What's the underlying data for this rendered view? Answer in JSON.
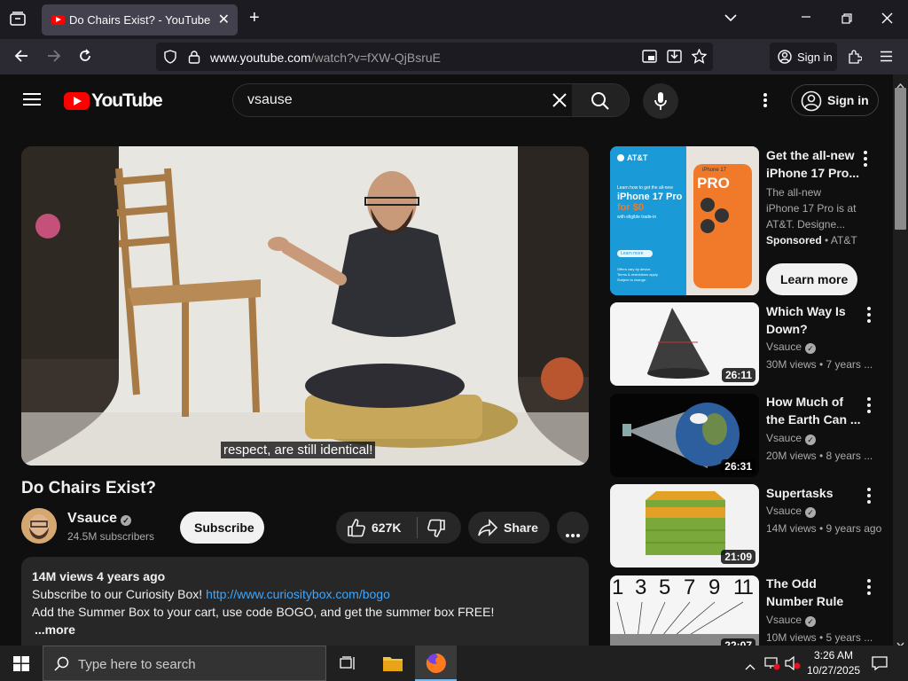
{
  "browser": {
    "tab_title": "Do Chairs Exist? - YouTube",
    "url_host": "www.youtube.com",
    "url_path": "/watch?v=fXW-QjBsruE",
    "signin_label": "Sign in"
  },
  "header": {
    "logo_text": "YouTube",
    "search_value": "vsause",
    "signin_label": "Sign in"
  },
  "video": {
    "caption": "respect, are still identical!",
    "title": "Do Chairs Exist?",
    "channel": "Vsauce",
    "subscribers": "24.5M subscribers",
    "subscribe_label": "Subscribe",
    "likes": "627K",
    "share_label": "Share"
  },
  "description": {
    "meta": "14M views  4 years ago",
    "line1_text": "Subscribe to our Curiosity Box! ",
    "line1_link": "http://www.curiositybox.com/bogo",
    "line2": "Add the Summer Box to your cart, use code BOGO, and get the summer box FREE!",
    "more": "...more"
  },
  "sidebar": {
    "ad": {
      "title": "Get the all-new iPhone 17 Pro...",
      "desc": "The all-new iPhone 17 Pro is at AT&T. Designe...",
      "sponsored": "Sponsored",
      "advertiser": "AT&T",
      "cta": "Learn more",
      "thumb_brand": "AT&T",
      "thumb_tag": "iPhone 17",
      "thumb_pro": "PRO",
      "thumb_headline1": "iPhone 17 Pro",
      "thumb_headline2": "for $0",
      "thumb_small": "Learn how to get the all-new",
      "thumb_trade": "with eligible trade-in",
      "thumb_btn": "Learn more",
      "thumb_fine1": "Offers vary by device.",
      "thumb_fine2": "Terms & restrictions apply.",
      "thumb_fine3": "Subject to change."
    },
    "videos": [
      {
        "title": "Which Way Is Down?",
        "channel": "Vsauce",
        "meta": "30M views • 7 years ...",
        "duration": "26:11"
      },
      {
        "title": "How Much of the Earth Can ...",
        "channel": "Vsauce",
        "meta": "20M views • 8 years ...",
        "duration": "26:31"
      },
      {
        "title": "Supertasks",
        "channel": "Vsauce",
        "meta": "14M views • 9 years ago",
        "duration": "21:09"
      },
      {
        "title": "The Odd Number Rule",
        "channel": "Vsauce",
        "meta": "10M views • 5 years ...",
        "duration": "22:07",
        "thumb_digits": [
          "1",
          "3",
          "5",
          "7",
          "9",
          "11"
        ]
      }
    ]
  },
  "taskbar": {
    "search_placeholder": "Type here to search",
    "time": "3:26 AM",
    "date": "10/27/2025"
  }
}
